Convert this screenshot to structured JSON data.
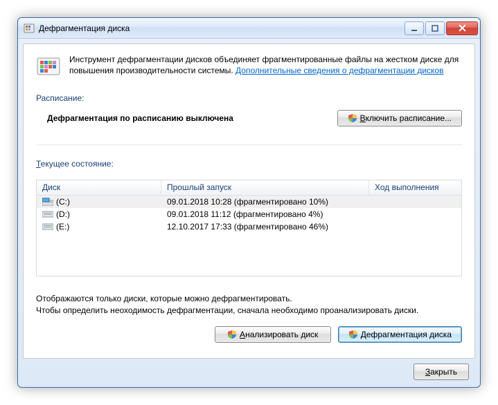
{
  "window": {
    "title": "Дефрагментация диска"
  },
  "intro": {
    "text": "Инструмент дефрагментации дисков объединяет фрагментированные файлы на жестком диске для повышения производительности системы. ",
    "link": "Дополнительные сведения о дефрагментации дисков"
  },
  "schedule": {
    "label": "Расписание:",
    "status": "Дефрагментация по расписанию выключена",
    "enable_button": "Включить расписание..."
  },
  "current_state_label": "Текущее состояние:",
  "columns": {
    "disk": "Диск",
    "last_run": "Прошлый запуск",
    "progress": "Ход выполнения"
  },
  "disks": [
    {
      "name": "(C:)",
      "last_run": "09.01.2018 10:28 (фрагментировано 10%)",
      "selected": true,
      "type": "primary"
    },
    {
      "name": "(D:)",
      "last_run": "09.01.2018 11:12 (фрагментировано 4%)",
      "selected": false,
      "type": "hdd"
    },
    {
      "name": "(E:)",
      "last_run": "12.10.2017 17:33 (фрагментировано 46%)",
      "selected": false,
      "type": "hdd"
    }
  ],
  "help": {
    "line1": "Отображаются только диски, которые можно дефрагментировать.",
    "line2": "Чтобы определить неоходимость дефрагментации, сначала необходимо проанализировать диски."
  },
  "buttons": {
    "analyze": "Анализировать диск",
    "defrag": "Дефрагментация диска",
    "close": "Закрыть"
  }
}
